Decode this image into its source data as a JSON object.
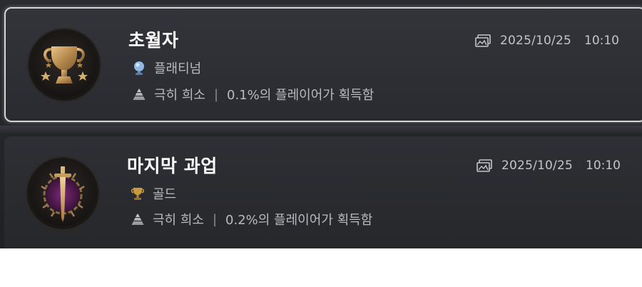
{
  "trophies": [
    {
      "name": "초월자",
      "grade_icon": "platinum-trophy-icon",
      "grade_label": "플래티넘",
      "rarity_icon": "ultra-rare-pyramid-icon",
      "rarity_label": "극히 희소",
      "rarity_separator": "|",
      "earned_text": "0.1%의 플레이어가 획득함",
      "date": "2025/10/25",
      "time": "10:10",
      "timestamp_icon": "screenshot-gallery-icon",
      "badge_icon": "golden-cup-with-stars-badge",
      "selected": true
    },
    {
      "name": "마지막 과업",
      "grade_icon": "gold-trophy-icon",
      "grade_label": "골드",
      "rarity_icon": "ultra-rare-pyramid-icon",
      "rarity_label": "극히 희소",
      "rarity_separator": "|",
      "earned_text": "0.2%의 플레이어가 획득함",
      "date": "2025/10/25",
      "time": "10:10",
      "timestamp_icon": "screenshot-gallery-icon",
      "badge_icon": "dagger-and-thorns-badge",
      "selected": false
    }
  ],
  "colors": {
    "panel_bg": "#24252a",
    "title_text": "#ffffff",
    "secondary_text": "#b9bac0",
    "platinum": "#8fb8e6",
    "gold": "#c89a3c",
    "selection_border": "#d6d3d9"
  }
}
